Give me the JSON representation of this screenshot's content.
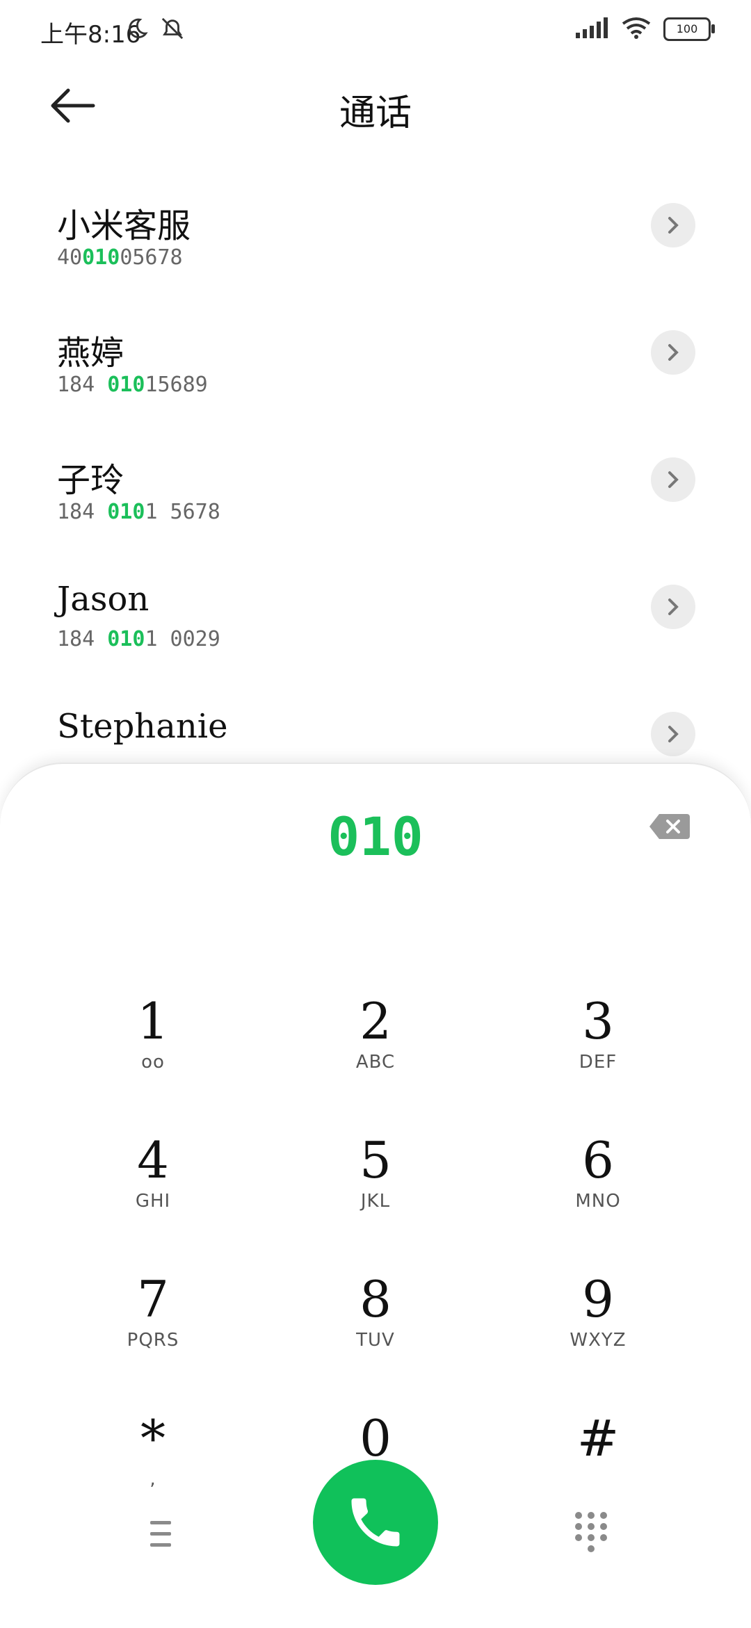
{
  "status": {
    "time": "上午8:16",
    "battery": "100"
  },
  "header": {
    "title": "通话"
  },
  "contacts": [
    {
      "name": "小米客服",
      "num_pre": "40",
      "num_hl": "010",
      "num_post": "05678"
    },
    {
      "name": "燕婷",
      "num_pre": "184 ",
      "num_hl": "010",
      "num_post": "15689"
    },
    {
      "name": "子玲",
      "num_pre": "184 ",
      "num_hl": "010",
      "num_post": "1 5678"
    },
    {
      "name": "Jason",
      "num_pre": "184 ",
      "num_hl": "010",
      "num_post": "1 0029"
    },
    {
      "name": "Stephanie",
      "num_pre": "",
      "num_hl": "",
      "num_post": ""
    }
  ],
  "dialer": {
    "typed": "010",
    "keys": [
      {
        "digit": "1",
        "letters": "oo"
      },
      {
        "digit": "2",
        "letters": "ABC"
      },
      {
        "digit": "3",
        "letters": "DEF"
      },
      {
        "digit": "4",
        "letters": "GHI"
      },
      {
        "digit": "5",
        "letters": "JKL"
      },
      {
        "digit": "6",
        "letters": "MNO"
      },
      {
        "digit": "7",
        "letters": "PQRS"
      },
      {
        "digit": "8",
        "letters": "TUV"
      },
      {
        "digit": "9",
        "letters": "WXYZ"
      },
      {
        "digit": "*",
        "letters": ","
      },
      {
        "digit": "0",
        "letters": "+"
      },
      {
        "digit": "#",
        "letters": ""
      }
    ]
  },
  "colors": {
    "accent": "#1bbf5a",
    "call_button": "#10c15a"
  }
}
